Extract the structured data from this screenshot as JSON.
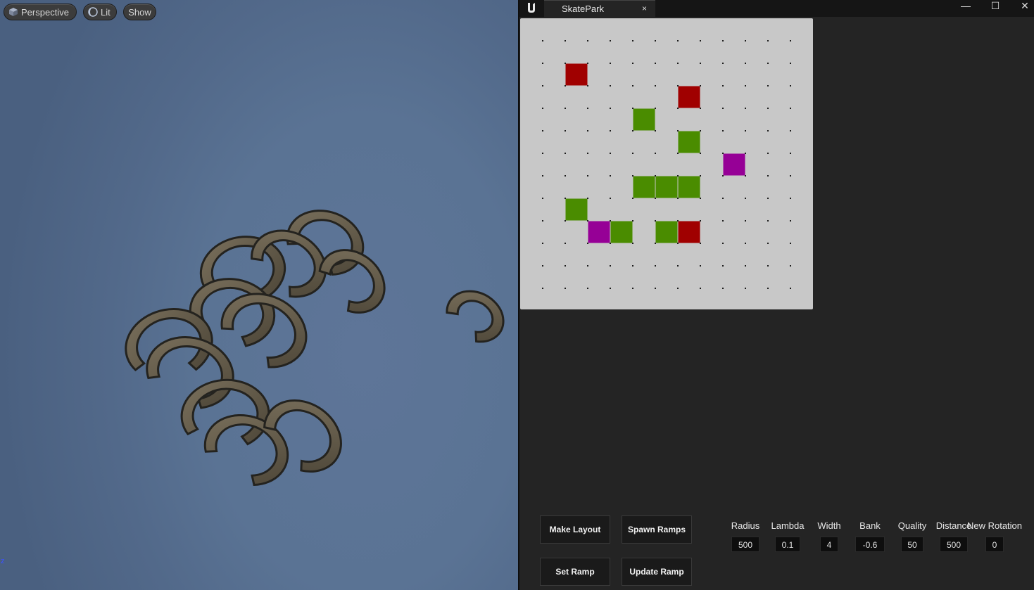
{
  "viewport": {
    "toolbar": {
      "perspective_label": "Perspective",
      "lit_label": "Lit",
      "show_label": "Show"
    },
    "axis_label": "z"
  },
  "window": {
    "tab_title": "SkatePark",
    "tab_close": "×",
    "minimize": "—",
    "maximize": "☐",
    "close": "✕"
  },
  "grid": {
    "cols": 13,
    "rows": 13,
    "colors": {
      "red": "#a00000",
      "green": "#4a8c00",
      "purple": "#960096",
      "background": "#c8c8c8"
    },
    "cells": [
      {
        "col": 2,
        "row": 2,
        "color": "red"
      },
      {
        "col": 7,
        "row": 3,
        "color": "red"
      },
      {
        "col": 5,
        "row": 4,
        "color": "green"
      },
      {
        "col": 7,
        "row": 5,
        "color": "green"
      },
      {
        "col": 9,
        "row": 6,
        "color": "purple"
      },
      {
        "col": 5,
        "row": 7,
        "color": "green"
      },
      {
        "col": 6,
        "row": 7,
        "color": "green"
      },
      {
        "col": 7,
        "row": 7,
        "color": "green"
      },
      {
        "col": 2,
        "row": 8,
        "color": "green"
      },
      {
        "col": 3,
        "row": 9,
        "color": "purple"
      },
      {
        "col": 4,
        "row": 9,
        "color": "green"
      },
      {
        "col": 6,
        "row": 9,
        "color": "green"
      },
      {
        "col": 7,
        "row": 9,
        "color": "red"
      }
    ]
  },
  "buttons": {
    "make_layout": "Make Layout",
    "spawn_ramps": "Spawn Ramps",
    "set_ramp": "Set Ramp",
    "update_ramp": "Update Ramp"
  },
  "params": [
    {
      "label": "Radius",
      "value": "500"
    },
    {
      "label": "Lambda",
      "value": "0.1"
    },
    {
      "label": "Width",
      "value": "4"
    },
    {
      "label": "Bank",
      "value": "-0.6"
    },
    {
      "label": "Quality",
      "value": "50"
    },
    {
      "label": "Distance",
      "value": "500"
    },
    {
      "label": "New Rotation",
      "value": "0"
    }
  ]
}
